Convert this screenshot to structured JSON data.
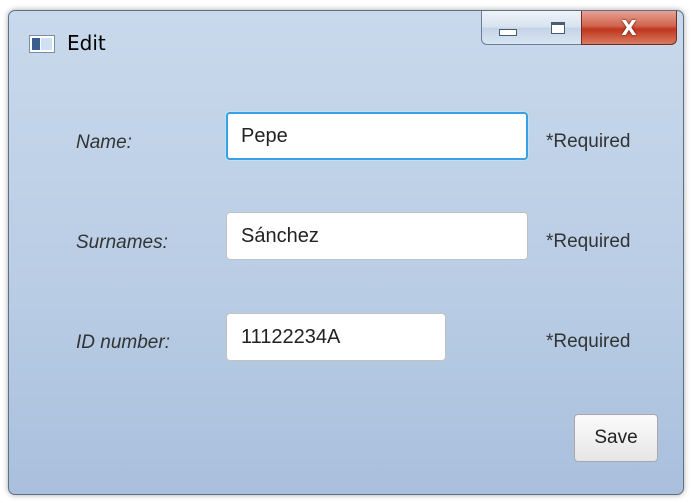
{
  "window": {
    "title": "Edit",
    "controls": {
      "minimize_icon": "minimize-icon",
      "maximize_icon": "maximize-icon",
      "close_glyph": "X"
    }
  },
  "form": {
    "fields": [
      {
        "label": "Name:",
        "value": "Pepe",
        "note": "*Required"
      },
      {
        "label": "Surnames:",
        "value": "Sánchez",
        "note": "*Required"
      },
      {
        "label": "ID number:",
        "value": "11122234A",
        "note": "*Required"
      }
    ],
    "save_label": "Save"
  },
  "colors": {
    "focus_border": "#3aa0e6",
    "client_background": "#f4f4f4",
    "close_button": "#c0361f"
  }
}
